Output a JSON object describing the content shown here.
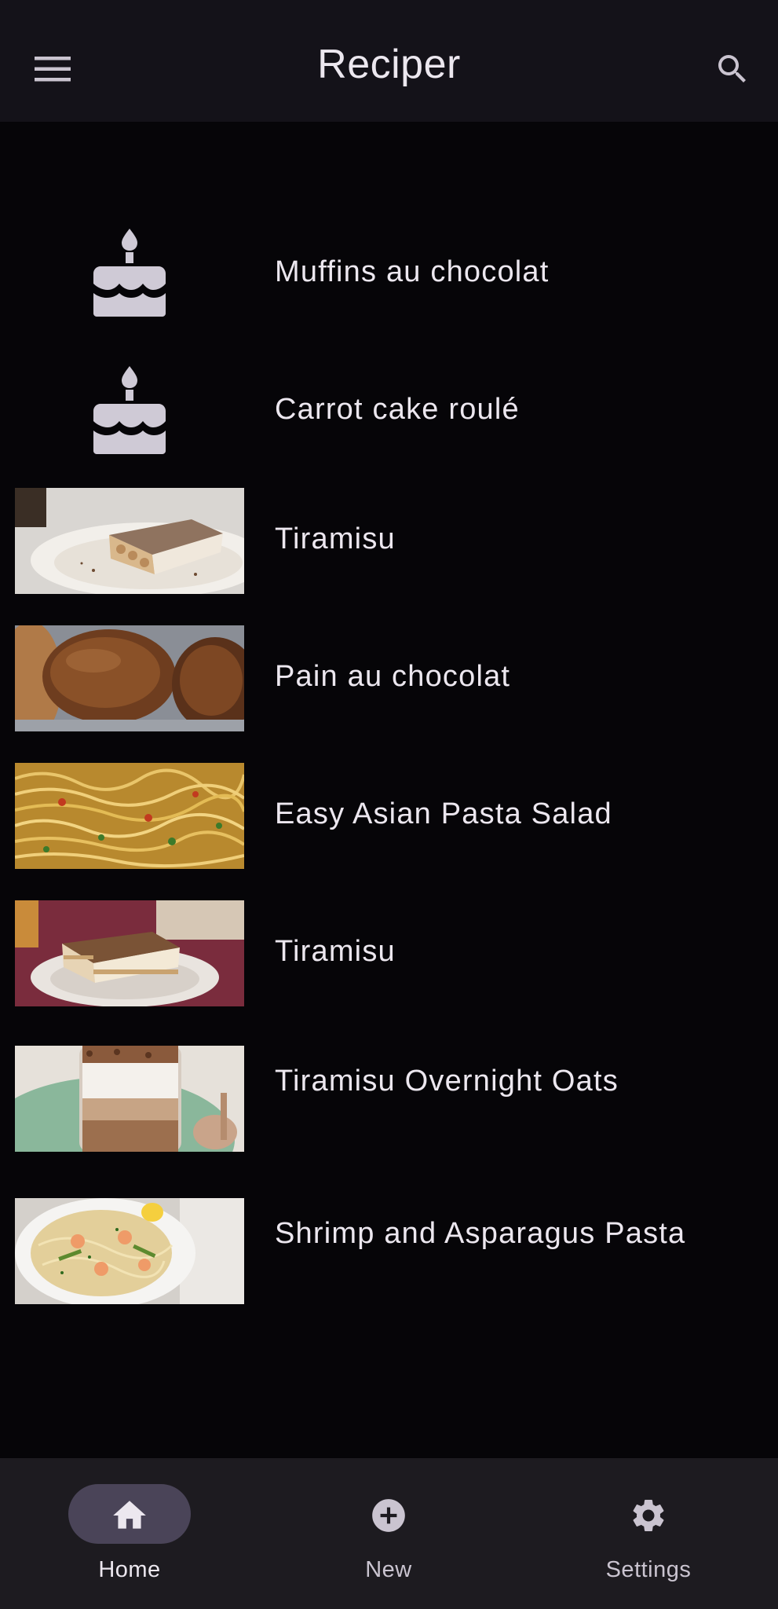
{
  "app_bar": {
    "title": "Reciper",
    "menu_icon": "menu-icon",
    "search_icon": "search-icon"
  },
  "recipes": [
    {
      "title": "Muffins au chocolat",
      "image": "cake-placeholder-icon"
    },
    {
      "title": "Carrot cake roulé",
      "image": "cake-placeholder-icon"
    },
    {
      "title": "Tiramisu",
      "image": "tiramisu-photo"
    },
    {
      "title": "Pain au chocolat",
      "image": "pain-au-chocolat-photo"
    },
    {
      "title": "Easy Asian Pasta Salad",
      "image": "pasta-salad-photo"
    },
    {
      "title": "Tiramisu",
      "image": "tiramisu-slice-photo"
    },
    {
      "title": " Tiramisu Overnight Oats",
      "image": "overnight-oats-photo"
    },
    {
      "title": " Shrimp and Asparagus Pasta",
      "image": "shrimp-pasta-photo"
    }
  ],
  "bottom_nav": {
    "items": [
      {
        "label": "Home",
        "icon": "home-icon",
        "active": true
      },
      {
        "label": "New",
        "icon": "add-circle-icon",
        "active": false
      },
      {
        "label": "Settings",
        "icon": "gear-icon",
        "active": false
      }
    ]
  },
  "colors": {
    "background": "#060508",
    "app_bar": "#141219",
    "nav_bar": "#1d1b20",
    "nav_indicator": "#4a4458",
    "text": "#ece7ef",
    "icon": "#cac4d0"
  }
}
